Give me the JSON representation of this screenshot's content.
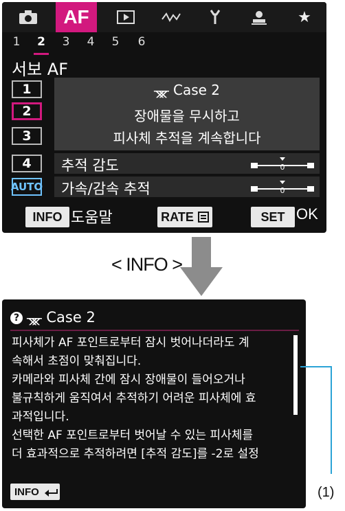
{
  "top_screen": {
    "tabs": [
      {
        "icon": "camera-icon",
        "label": ""
      },
      {
        "icon": "",
        "label": "AF"
      },
      {
        "icon": "playback-icon",
        "label": ""
      },
      {
        "icon": "wave-icon",
        "label": ""
      },
      {
        "icon": "wrench-icon",
        "label": ""
      },
      {
        "icon": "custom-icon",
        "label": ""
      },
      {
        "icon": "star-icon",
        "label": ""
      }
    ],
    "subtabs": [
      "1",
      "2",
      "3",
      "4",
      "5",
      "6"
    ],
    "active_subtab": "2",
    "title": "서보 AF",
    "cases": [
      "1",
      "2",
      "3",
      "4",
      "AUTO"
    ],
    "selected_case": "2",
    "case_name": "Case 2",
    "desc_line1": "장애물을 무시하고",
    "desc_line2": "피사체 추적을 계속합니다",
    "param1": "추적 감도",
    "param2": "가속/감속 추적",
    "info_key": "INFO",
    "info_text": "도움말",
    "rate_key": "RATE",
    "set_key": "SET",
    "ok_text": "OK"
  },
  "caption": "< INFO >",
  "help_screen": {
    "title": "Case 2",
    "lines": [
      "피사체가 AF 포인트로부터 잠시 벗어나더라도 계",
      "속해서 초점이 맞춰집니다.",
      "카메라와 피사체 간에 잠시 장애물이 들어오거나",
      "불규칙하게 움직여서 추적하기 어려운 피사체에 효",
      "과적입니다.",
      "선택한 AF 포인트로부터 벗어날 수 있는 피사체를",
      "더 효과적으로 추적하려면 [추적 감도]를 -2로 설정"
    ],
    "info_key": "INFO"
  },
  "callout": "(1)",
  "colors": {
    "accent": "#d2197e",
    "auto_blue": "#6fc3ff"
  }
}
